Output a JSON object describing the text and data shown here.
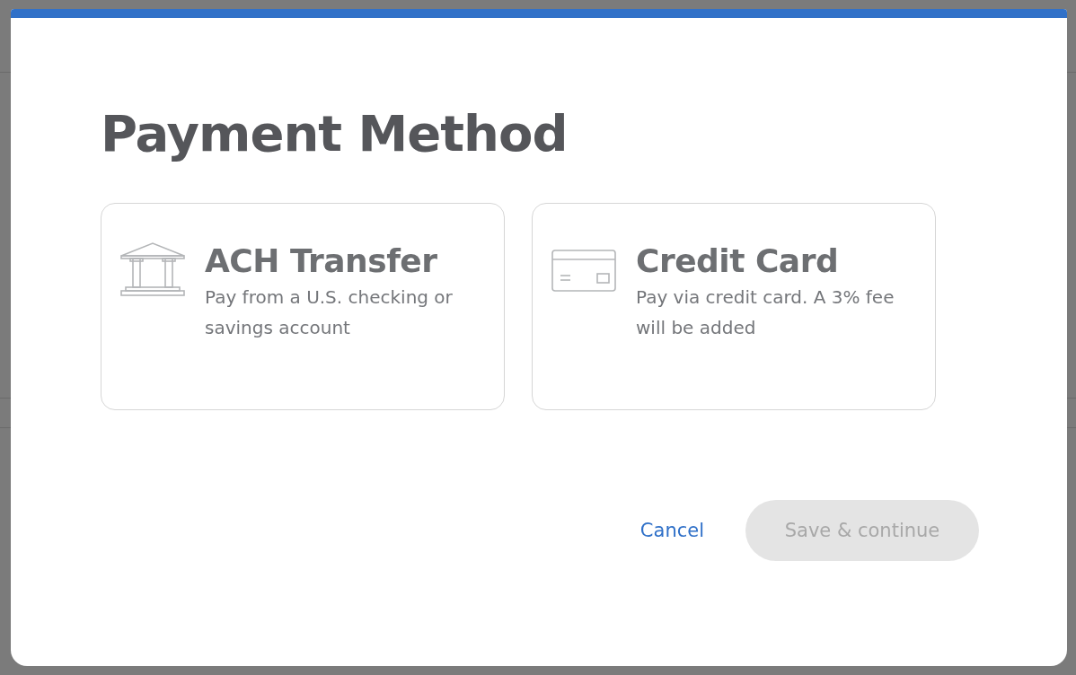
{
  "dialog": {
    "title": "Payment Method",
    "options": [
      {
        "kind": "bank",
        "title": "ACH Transfer",
        "description": "Pay from a U.S. checking or savings account",
        "selected": false
      },
      {
        "kind": "card",
        "title": "Credit Card",
        "description": "Pay via credit card. A 3% fee will be added",
        "selected": false
      }
    ],
    "cancel": "Cancel",
    "submit": {
      "label": "Save & continue",
      "disabled": true
    }
  }
}
